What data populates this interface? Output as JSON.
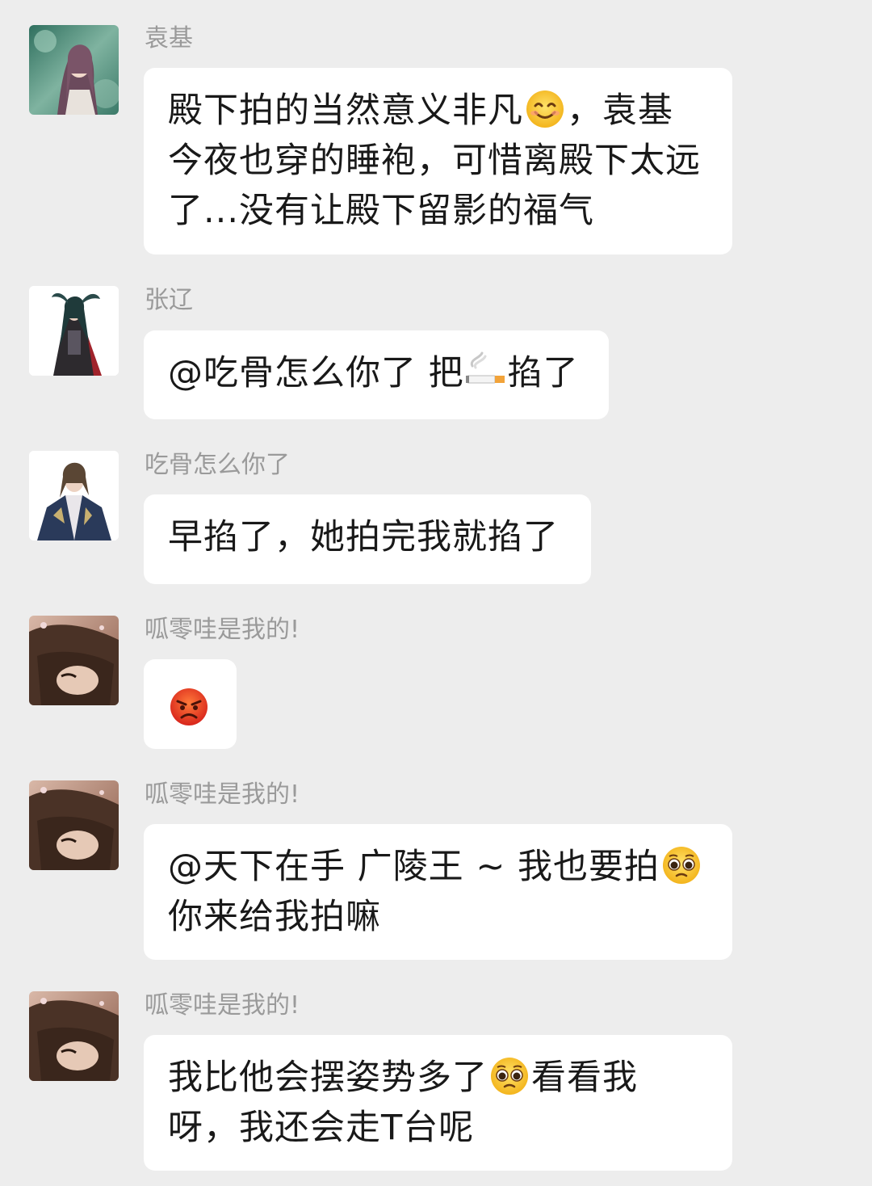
{
  "messages": [
    {
      "sender": "袁基",
      "avatar": "avatar-yuanji",
      "parts": [
        "殿下拍的当然意义非凡",
        "，袁基今夜也穿的睡袍，可惜离殿下太远了...没有让殿下留影的福气"
      ],
      "emoji": "smiling-face-icon"
    },
    {
      "sender": "张辽",
      "avatar": "avatar-zhangliao",
      "parts": [
        "@吃骨怎么你了 把",
        "掐了"
      ],
      "emoji": "cigarette-icon"
    },
    {
      "sender": "吃骨怎么你了",
      "avatar": "avatar-chigu",
      "parts": [
        "早掐了，她拍完我就掐了"
      ]
    },
    {
      "sender": "呱零哇是我的!",
      "avatar": "avatar-gualing",
      "emoji": "angry-face-icon"
    },
    {
      "sender": "呱零哇是我的!",
      "avatar": "avatar-gualing",
      "parts": [
        "@天下在手 广陵王 ~ 我也要拍",
        "你来给我拍嘛"
      ],
      "emoji": "pleading-face-icon"
    },
    {
      "sender": "呱零哇是我的!",
      "avatar": "avatar-gualing",
      "parts": [
        "我比他会摆姿势多了",
        "看看我呀，我还会走T台呢"
      ],
      "emoji": "pleading-face-icon"
    }
  ],
  "colors": {
    "background": "#ededed",
    "bubble": "#ffffff",
    "sender_text": "#9a9a9a",
    "message_text": "#191919"
  }
}
